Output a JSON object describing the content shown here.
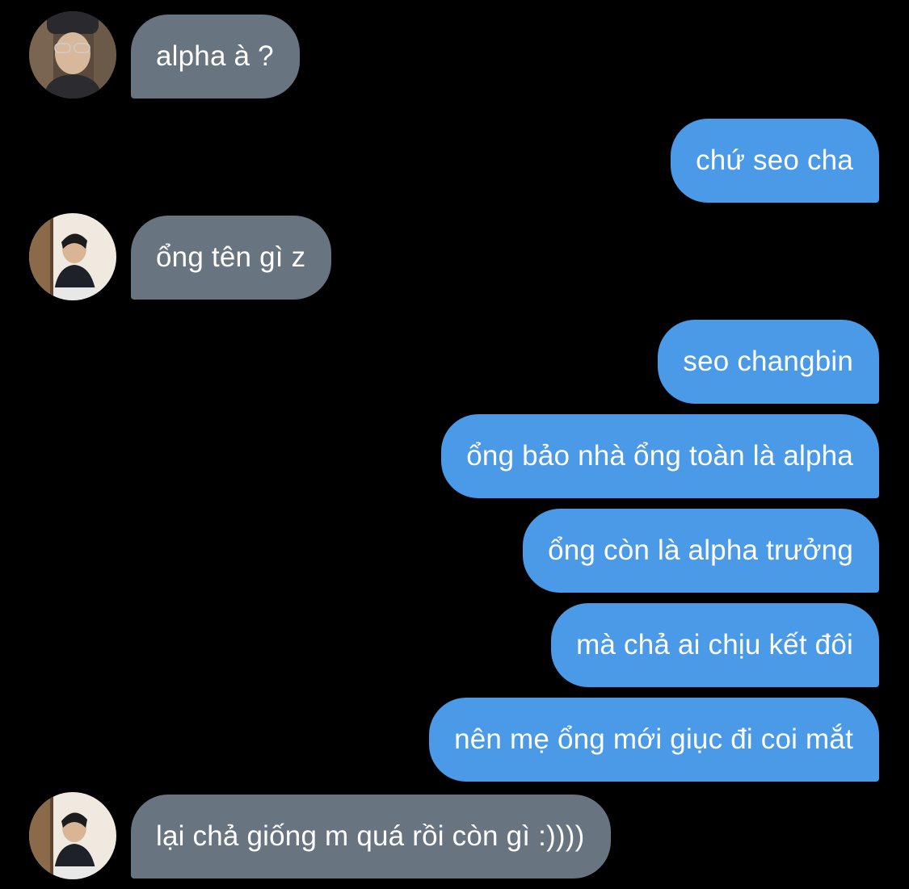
{
  "conversation": {
    "messages": [
      {
        "sender": "them",
        "text": "alpha à ?"
      },
      {
        "sender": "me",
        "text": "chứ seo cha"
      },
      {
        "sender": "them",
        "text": "ổng tên gì z"
      },
      {
        "sender": "me",
        "text": "seo changbin"
      },
      {
        "sender": "me",
        "text": "ổng bảo nhà ổng toàn là alpha"
      },
      {
        "sender": "me",
        "text": "ổng còn là alpha trưởng"
      },
      {
        "sender": "me",
        "text": "mà chả ai chịu kết đôi"
      },
      {
        "sender": "me",
        "text": "nên mẹ ổng mới giục đi coi mắt"
      },
      {
        "sender": "them",
        "text": "lại chả giống m quá rồi còn gì :))))"
      }
    ]
  },
  "colors": {
    "background": "#000000",
    "incoming_bubble": "#687480",
    "outgoing_bubble": "#4a9ae8",
    "text": "#ffffff"
  },
  "icons": {
    "avatar_1": "avatar-photo-glasses-beanie",
    "avatar_2": "avatar-photo-portrait",
    "avatar_3": "avatar-photo-portrait"
  }
}
